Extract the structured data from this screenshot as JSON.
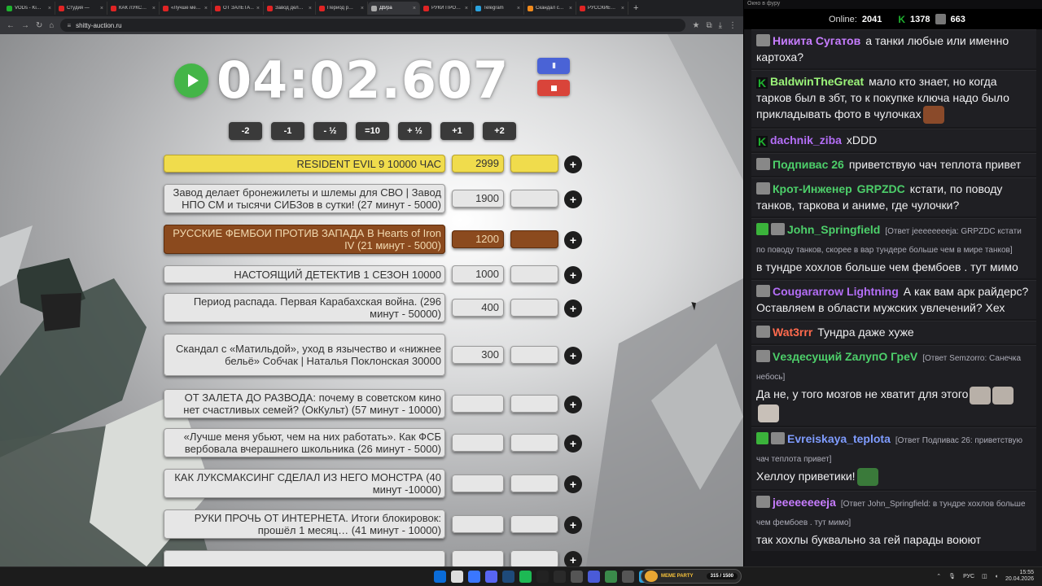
{
  "browser": {
    "tabs": [
      {
        "label": "VODs - Ki…",
        "color": "#1fb12f"
      },
      {
        "label": "Студия —",
        "color": "#e02424"
      },
      {
        "label": "КАК ЛУКС…",
        "color": "#e02424"
      },
      {
        "label": "«Лучше ме…",
        "color": "#e02424"
      },
      {
        "label": "ОТ ЗАЛЕТА…",
        "color": "#e02424"
      },
      {
        "label": "Завод дел…",
        "color": "#e02424"
      },
      {
        "label": "Период р…",
        "color": "#e02424"
      },
      {
        "label": "Дb/pa",
        "color": "#aaaaaa",
        "active": true
      },
      {
        "label": "РУКИ ПРО…",
        "color": "#e02424"
      },
      {
        "label": "Telegram",
        "color": "#2aa3df"
      },
      {
        "label": "Скандал с…",
        "color": "#f08a1c"
      },
      {
        "label": "РУССКИЕ…",
        "color": "#e02424"
      }
    ],
    "url": "shitty-auction.ru"
  },
  "timer": {
    "value": "04:02.607",
    "pause_label": "II"
  },
  "adjust_buttons": [
    "-2",
    "-1",
    "- ½",
    "=10",
    "+ ½",
    "+1",
    "+2"
  ],
  "lots": [
    {
      "title": "RESIDENT EVIL 9 10000 ЧАС",
      "amount": "2999",
      "style": "gold"
    },
    {
      "title": "Завод делает бронежилеты и шлемы для СВО | Завод НПО СМ и тысячи СИБЗов в сутки! (27 минут - 5000)",
      "amount": "1900",
      "style": ""
    },
    {
      "title": "РУССКИЕ ФЕМБОИ ПРОТИВ ЗАПАДА В Hearts of Iron IV (21 минут - 5000)",
      "amount": "1200",
      "style": "brown"
    },
    {
      "title": "НАСТОЯЩИЙ ДЕТЕКТИВ 1 СЕЗОН 10000",
      "amount": "1000",
      "style": ""
    },
    {
      "title": "Период распада. Первая Карабахская война. (296 минут - 50000)",
      "amount": "400",
      "style": ""
    },
    {
      "title": "Скандал с «Матильдой», уход в язычество и «нижнее бельё» Собчак | Наталья Поклонская 30000",
      "amount": "300",
      "style": ""
    },
    {
      "title": "ОТ ЗАЛЕТА ДО РАЗВОДА: почему в советском кино нет счастливых семей? (ОкКульт) (57 минут - 10000)",
      "amount": "",
      "style": ""
    },
    {
      "title": "«Лучше меня убьют, чем на них работать». Как ФСБ вербовала вчерашнего школьника (26 минут - 5000)",
      "amount": "",
      "style": ""
    },
    {
      "title": "КАК ЛУКСМАКСИНГ СДЕЛАЛ ИЗ НЕГО МОНСТРА (40 минут -10000)",
      "amount": "",
      "style": ""
    },
    {
      "title": "РУКИ ПРОЧЬ ОТ ИНТЕРНЕТА. Итоги блокировок: прошёл 1 месяц… (41 минут - 10000)",
      "amount": "",
      "style": ""
    },
    {
      "title": "",
      "amount": "",
      "style": ""
    }
  ],
  "plus_label": "+",
  "chat_header": "Окно в фуру",
  "stats": {
    "online_label": "Online:",
    "online_value": "2041",
    "count1": "1378",
    "count2": "663"
  },
  "chat": [
    {
      "name": "Никита Сугатов",
      "color": "#c77dff",
      "badge": "ava",
      "text": "а танки любые или именно картоха?"
    },
    {
      "name": "BaldwinTheGreat",
      "color": "#9cf57a",
      "badge": "k",
      "text": "мало кто знает, но когда тарков был в збт, то к покупке ключа надо было прикладывать фото в чулочках",
      "emote": "#8a4a2a"
    },
    {
      "name": "dachnik_ziba",
      "color": "#b46ef7",
      "badge": "k",
      "text": "xDDD"
    },
    {
      "name": "Подпивас 26",
      "color": "#4dcf6a",
      "badge": "ava",
      "text": "приветствую чач теплота привет"
    },
    {
      "name": "Крот-Инженер",
      "color": "#4dcf6a",
      "name2": "GRPZDC",
      "badge": "ava",
      "text": "кстати, по поводу танков, таркова и аниме, где чулочки?"
    },
    {
      "name": "John_Springfield",
      "color": "#4dcf6a",
      "badge": "green",
      "reply": "[Ответ jeeeeeeeeja: GRPZDC кстати по поводу танков, скорее в вар тундере больше чем в мире танков]",
      "text": "в тундре хохлов больше чем фембоев . тут мимо"
    },
    {
      "name": "Cougararrow Lightning",
      "color": "#b46ef7",
      "badge": "ava",
      "text": "А как вам арк райдерс? Оставляем в области мужских увлечений? Хех"
    },
    {
      "name": "Wat3rrr",
      "color": "#ff6a4d",
      "badge": "ava",
      "text": "Тундра даже хуже"
    },
    {
      "name": "Vездесущий ZалупО ГреV",
      "color": "#4dcf6a",
      "badge": "ava",
      "reply": "[Ответ Semzorro: Санечка небось]",
      "text": "Да не, у того мозгов не хватит для этого",
      "emote": "#b8b0a8",
      "emote2": "#b8b0a8",
      "emote3": "#c8c0b8"
    },
    {
      "name": "Evreiskaya_teplota",
      "color": "#7f9cff",
      "badge": "green",
      "reply": "[Ответ Подпивас 26: приветствую чач теплота привет]",
      "text": "Хеллоу приветики!",
      "emote": "#3a7a3a"
    },
    {
      "name": "jeeeeeeeeja",
      "color": "#c77dff",
      "badge": "ava",
      "reply": "[Ответ John_Springfield: в тундре хохлов больше чем фембоев . тут мимо]",
      "text": "так хохлы буквально за гей парады воюют"
    }
  ],
  "meme_party": {
    "label": "MEME PARTY",
    "progress": "315 / 1500"
  },
  "tray": {
    "lang": "РУС",
    "time": "15:55",
    "date": "20.04.2026"
  }
}
